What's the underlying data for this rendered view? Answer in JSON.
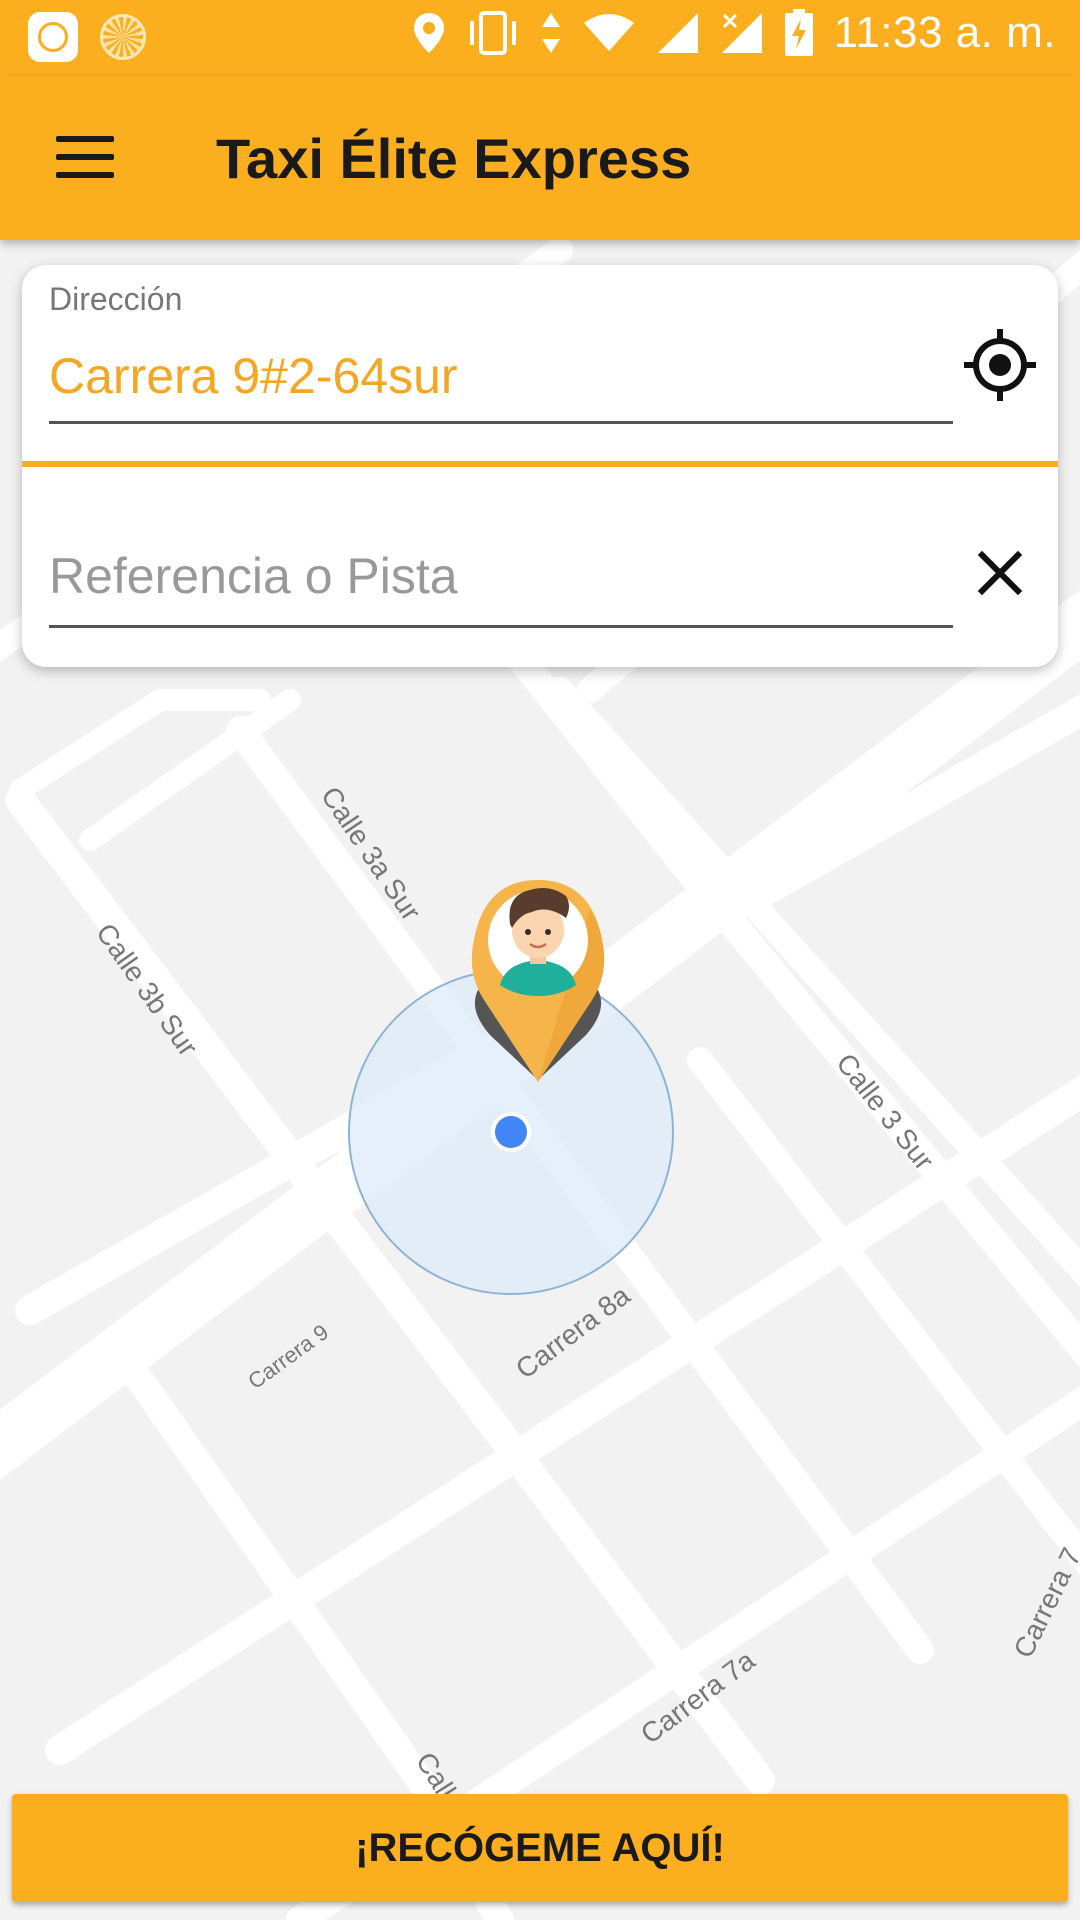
{
  "status_bar": {
    "time": "11:33 a. m.",
    "icons": [
      "mi-app-icon",
      "loading-icon",
      "location-icon",
      "vibrate-icon",
      "data-transfer-icon",
      "wifi-icon",
      "signal-icon",
      "signal-no-sim-icon",
      "battery-charging-icon"
    ]
  },
  "app_bar": {
    "title": "Taxi Élite Express",
    "menu_icon": "hamburger-menu-icon"
  },
  "address_card": {
    "address_label": "Dirección",
    "address_value": "Carrera 9#2-64sur",
    "locate_icon": "gps-crosshair-icon",
    "reference_placeholder": "Referencia o Pista",
    "reference_value": "",
    "clear_icon": "close-icon"
  },
  "map": {
    "street_labels": {
      "calle_3a_sur": "Calle 3a Sur",
      "calle_3b_sur": "Calle 3b Sur",
      "calle_3_sur": "Calle 3 Sur",
      "carrera_8a": "Carrera 8a",
      "carrera_9": "Carrera 9",
      "carrera_7a": "Carrera 7a",
      "carrera_7": "Carrera 7",
      "calle_partial": "Calle"
    },
    "pin_icon": "passenger-avatar-pin-icon",
    "location_dot_icon": "current-location-dot-icon"
  },
  "pickup_button": {
    "label": "¡RECÓGEME AQUÍ!"
  },
  "colors": {
    "accent": "#FBAE1E",
    "address_text": "#F5A623",
    "location_dot": "#4285F4",
    "accuracy_circle": "#DDEBF8"
  }
}
